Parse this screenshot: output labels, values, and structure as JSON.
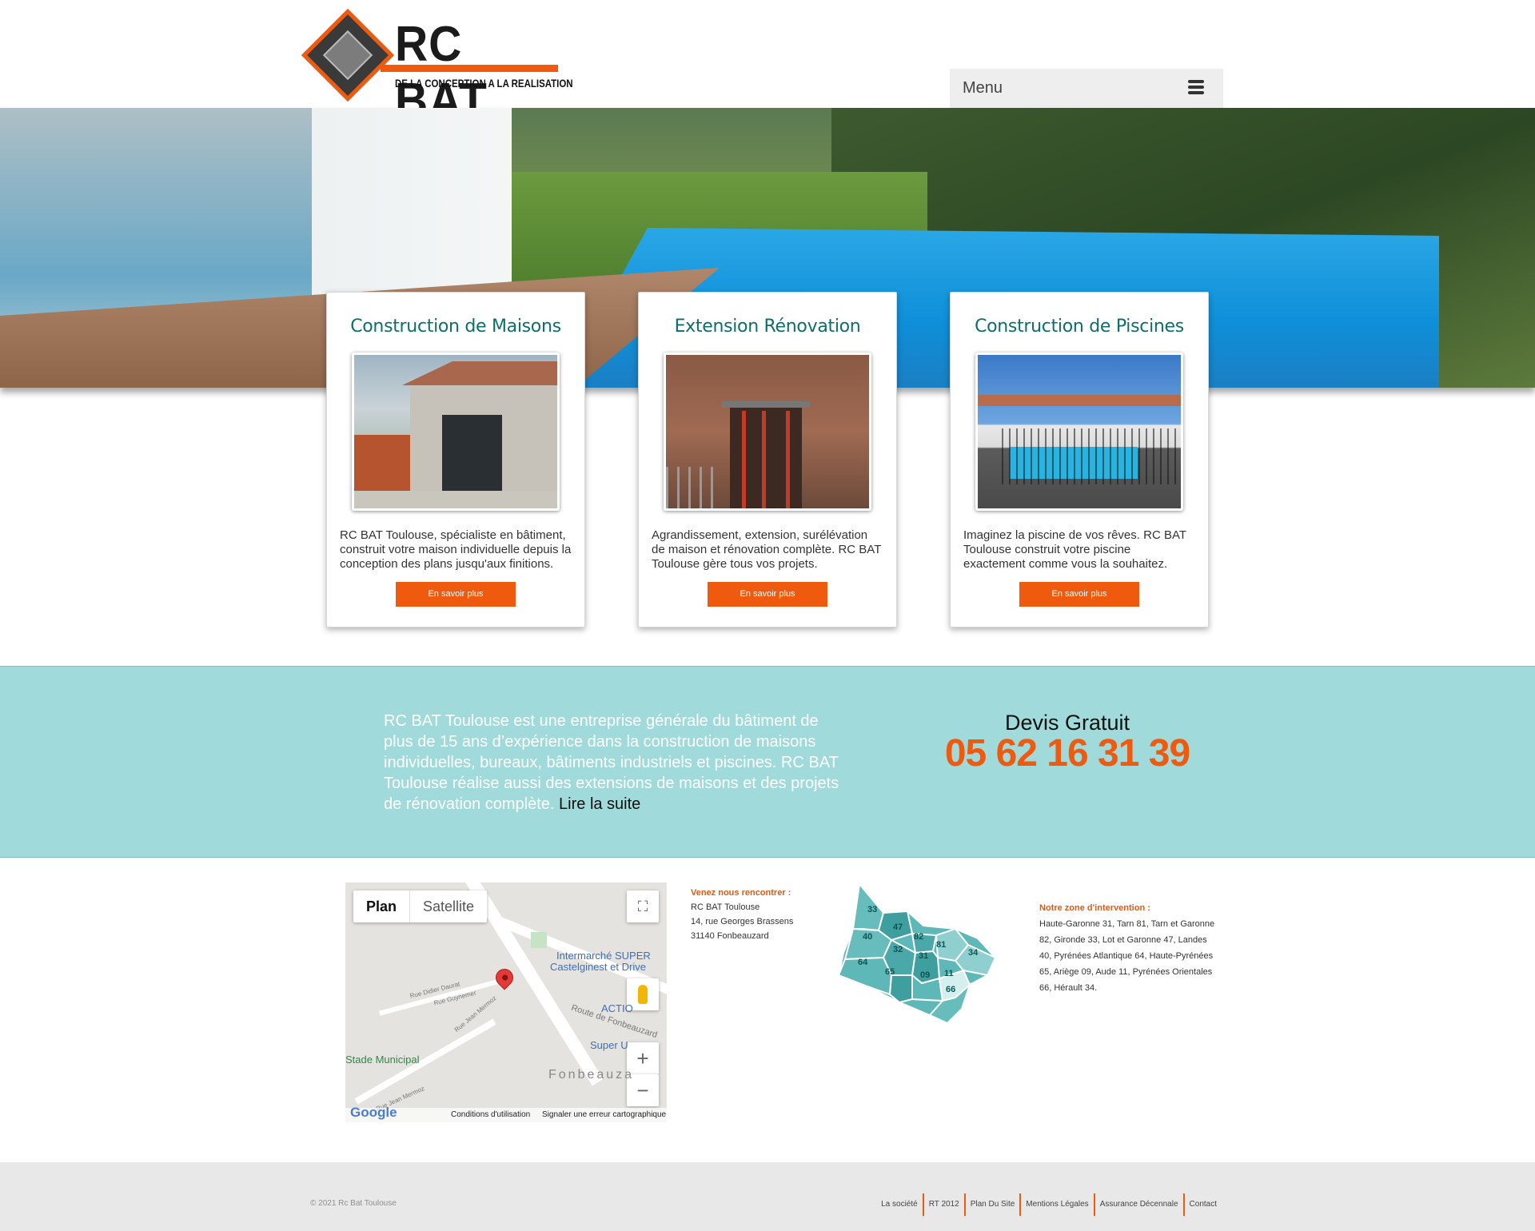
{
  "header": {
    "logo_title": "RC BAT",
    "logo_tagline": "DE LA CONCEPTION A LA REALISATION",
    "menu_label": "Menu"
  },
  "cards": [
    {
      "title": "Construction de Maisons",
      "text": "RC BAT Toulouse, spécialiste en bâtiment, construit votre maison individuelle depuis la conception des plans jusqu'aux finitions.",
      "button": "En savoir plus"
    },
    {
      "title": "Extension Rénovation",
      "text": "Agrandissement, extension, surélévation de maison et rénovation complète. RC BAT Toulouse gère tous vos projets.",
      "button": "En savoir plus"
    },
    {
      "title": "Construction de Piscines",
      "text": "Imaginez la piscine de vos rêves. RC BAT Toulouse construit votre piscine exactement comme vous la souhaitez.",
      "button": "En savoir plus"
    }
  ],
  "band": {
    "text": "RC BAT Toulouse est une entreprise générale du bâtiment de plus de 15 ans d’expérience dans la construction de maisons individuelles, bureaux, bâtiments industriels et piscines. RC BAT Toulouse réalise aussi des extensions de maisons et des projets de rénovation complète.",
    "link": "Lire la suite",
    "devis_label": "Devis Gratuit",
    "phone": "05 62 16 31 39"
  },
  "map": {
    "tab_plan": "Plan",
    "tab_satellite": "Satellite",
    "labels": {
      "intermarche": "Intermarché SUPER",
      "intermarche2": "Castelginest et Drive",
      "action": "ACTIO",
      "route": "Route de Fonbeauzard",
      "super": "Super U",
      "stade": "Stade Municipal",
      "town": "Fonbeauza",
      "rue_jean_mermoz": "Rue Jean Mermoz",
      "rue_jean_mermoz_2": "Rue Jean Mermoz",
      "rue_didier_daurat": "Rue Didier Daurat",
      "rue_guynemer": "Rue Guynemer"
    },
    "google": "Google",
    "terms": "Conditions d'utilisation",
    "report": "Signaler une erreur cartographique"
  },
  "contact": {
    "heading": "Venez nous rencontrer :",
    "lines": [
      "RC BAT Toulouse",
      "14, rue Georges Brassens",
      "31140 Fonbeauzard"
    ]
  },
  "region_map": {
    "departments": [
      "33",
      "47",
      "40",
      "82",
      "81",
      "32",
      "31",
      "34",
      "64",
      "65",
      "09",
      "11",
      "66"
    ]
  },
  "zone": {
    "heading": "Notre zone d'intervention :",
    "text": "Haute-Garonne 31, Tarn 81, Tarn et Garonne 82, Gironde 33, Lot et Garonne 47, Landes 40, Pyrénées Atlantique 64, Haute-Pyrénées 65, Ariège 09, Aude 11, Pyrénées Orientales 66, Hérault 34."
  },
  "footer": {
    "copyright": "© 2021 Rc Bat Toulouse",
    "links": [
      "La société",
      "RT 2012",
      "Plan Du Site",
      "Mentions Légales",
      "Assurance Décennale",
      "Contact"
    ]
  },
  "colors": {
    "accent": "#f05a0e",
    "teal_title": "#0d6f6a",
    "band_bg": "#a0dada",
    "region_fill": "#5fb8b8"
  }
}
